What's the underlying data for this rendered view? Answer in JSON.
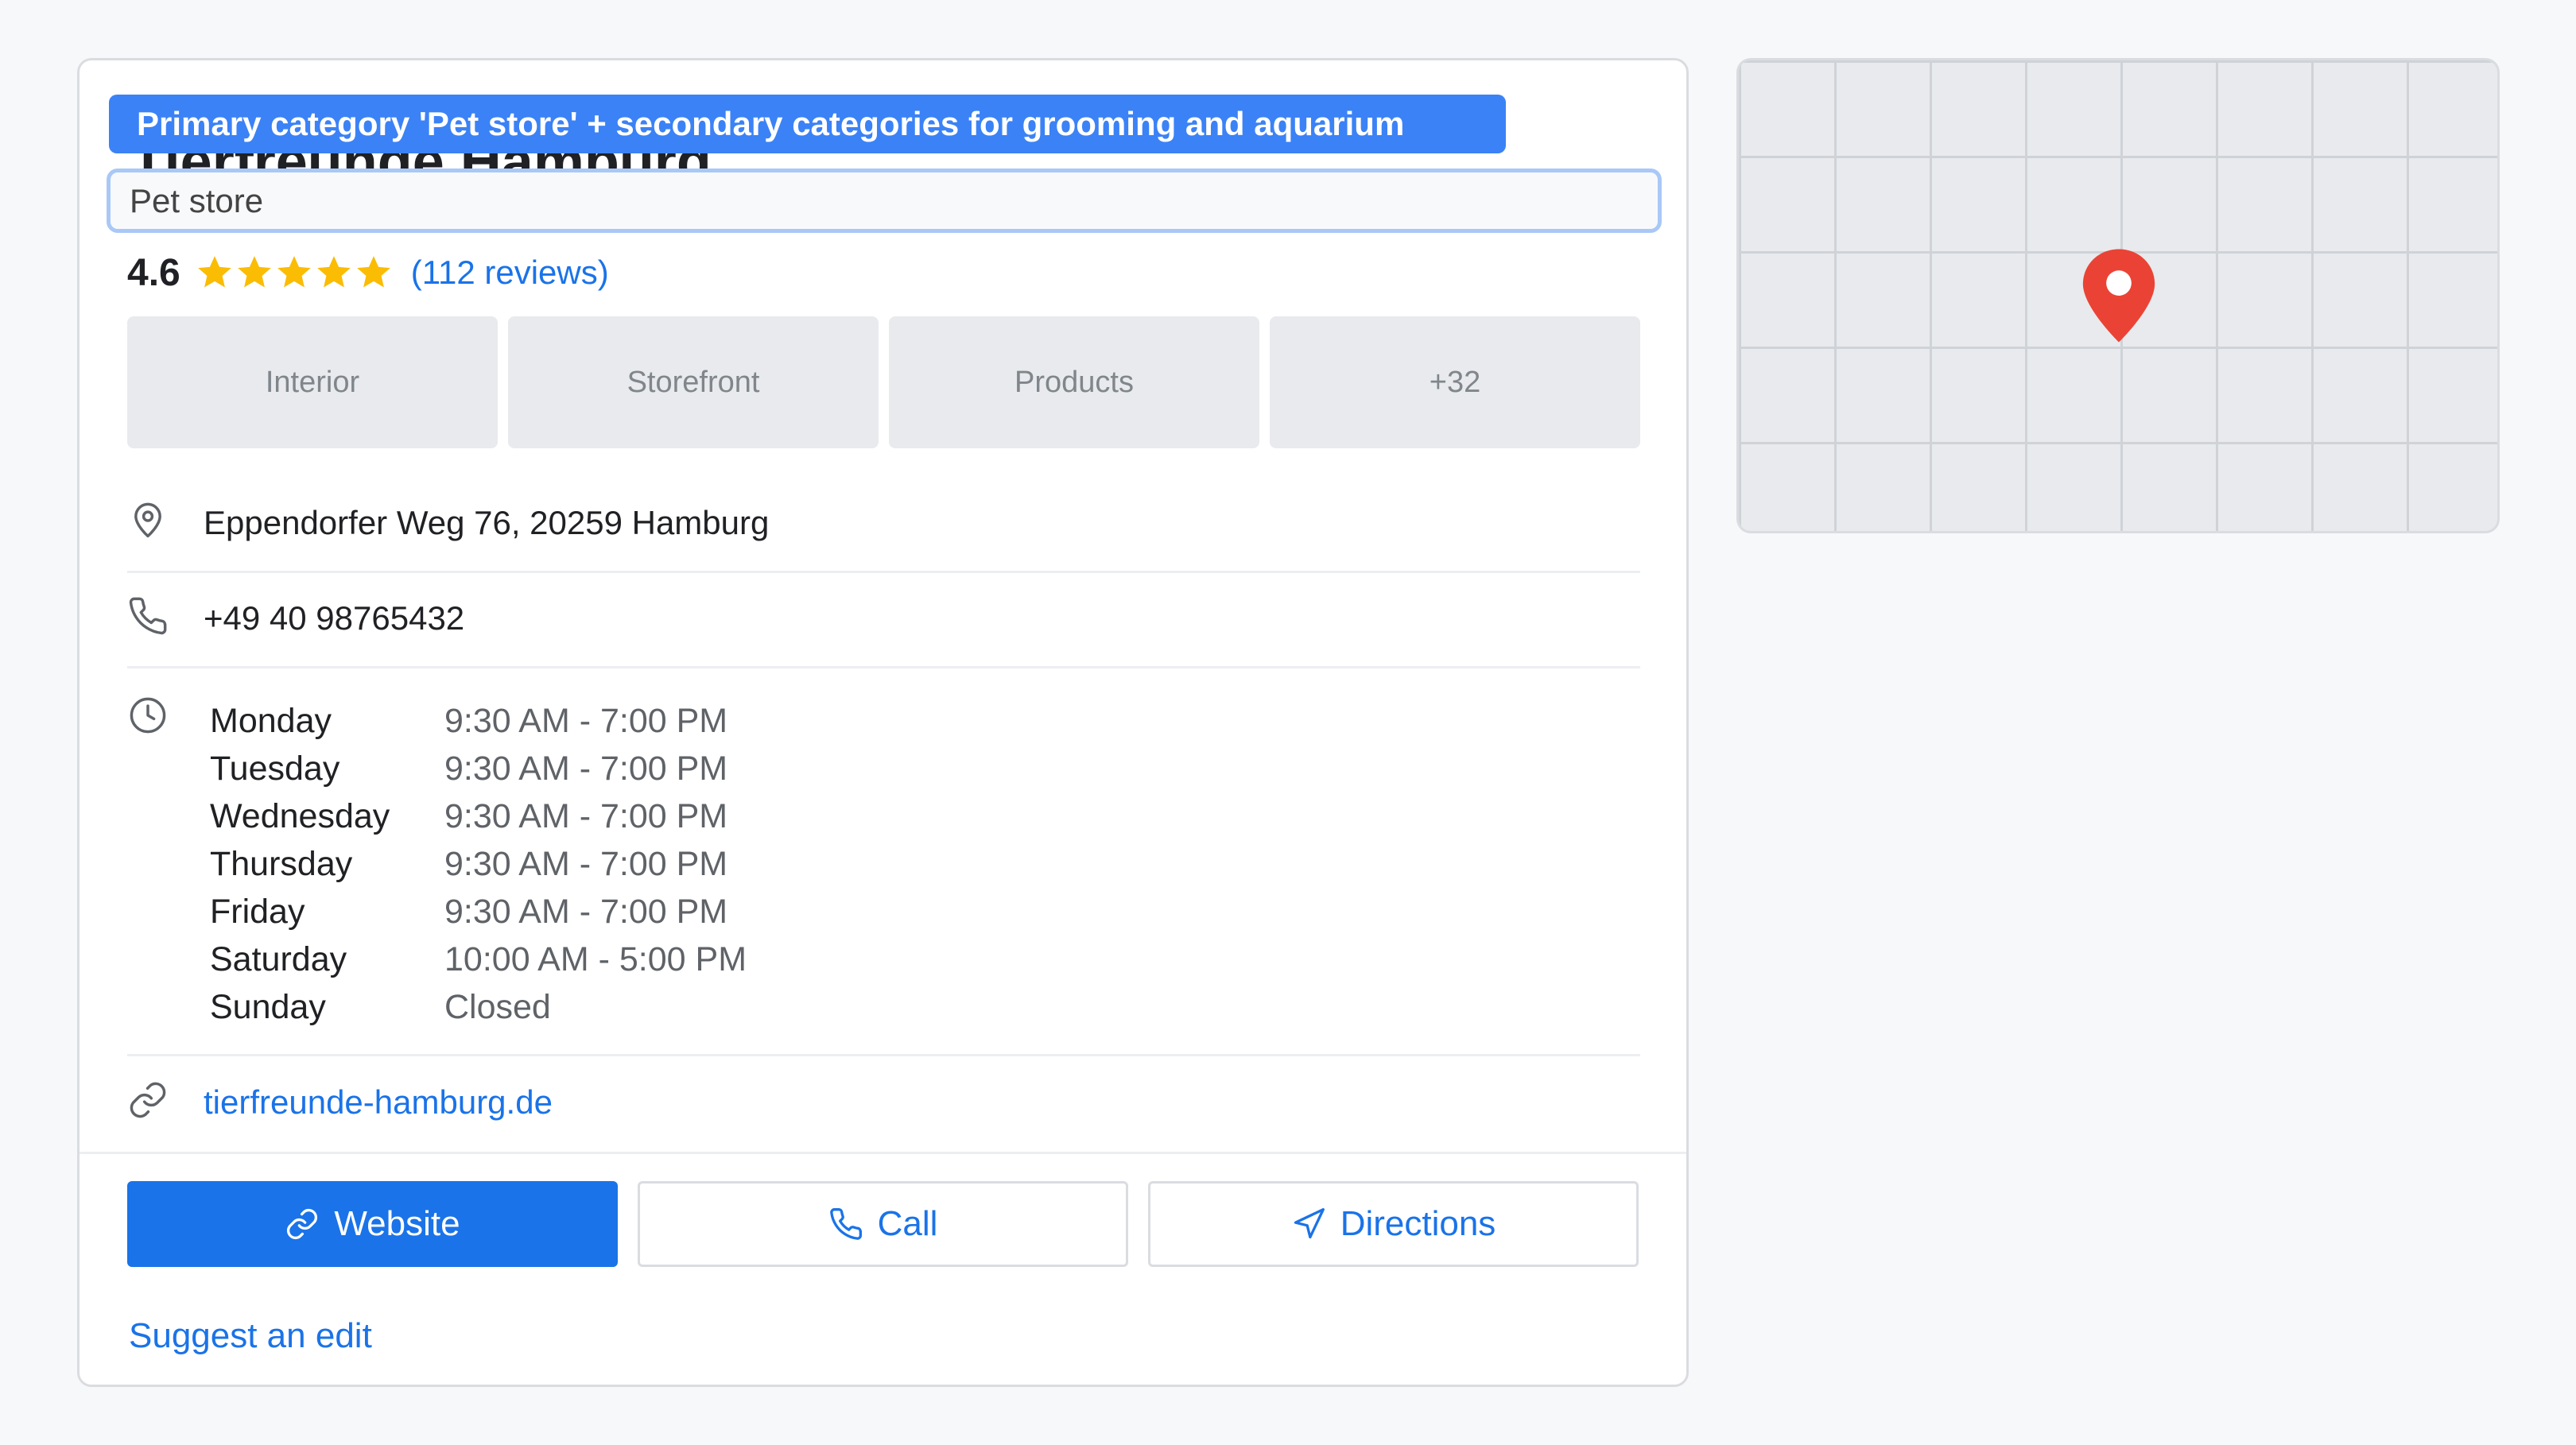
{
  "business": {
    "name": "Tierfreunde Hamburg",
    "category_banner": "Primary category 'Pet store' + secondary categories for grooming and aquarium",
    "category_value": "Pet store",
    "rating": "4.6",
    "stars": 5,
    "reviews_label": "(112 reviews)",
    "accent_color": "#1a73e8",
    "banner_color": "#3b82f6",
    "star_color": "#fbbc04"
  },
  "photos": [
    "Interior",
    "Storefront",
    "Products",
    "+32"
  ],
  "info": {
    "address": "Eppendorfer Weg 76, 20259 Hamburg",
    "address_icon": "location-pin-icon",
    "phone": "+49 40 98765432",
    "phone_icon": "phone-icon",
    "hours_icon": "clock-icon",
    "hours": [
      {
        "day": "Monday",
        "time": "9:30 AM - 7:00 PM"
      },
      {
        "day": "Tuesday",
        "time": "9:30 AM - 7:00 PM"
      },
      {
        "day": "Wednesday",
        "time": "9:30 AM - 7:00 PM"
      },
      {
        "day": "Thursday",
        "time": "9:30 AM - 7:00 PM"
      },
      {
        "day": "Friday",
        "time": "9:30 AM - 7:00 PM"
      },
      {
        "day": "Saturday",
        "time": "10:00 AM - 5:00 PM"
      },
      {
        "day": "Sunday",
        "time": "Closed"
      }
    ],
    "website": "tierfreunde-hamburg.de",
    "website_icon": "link-icon"
  },
  "actions": {
    "website_label": "Website",
    "call_label": "Call",
    "directions_label": "Directions",
    "suggest_label": "Suggest an edit"
  },
  "map": {
    "pin_icon": "map-marker-icon",
    "pin_color": "#ea4335"
  }
}
